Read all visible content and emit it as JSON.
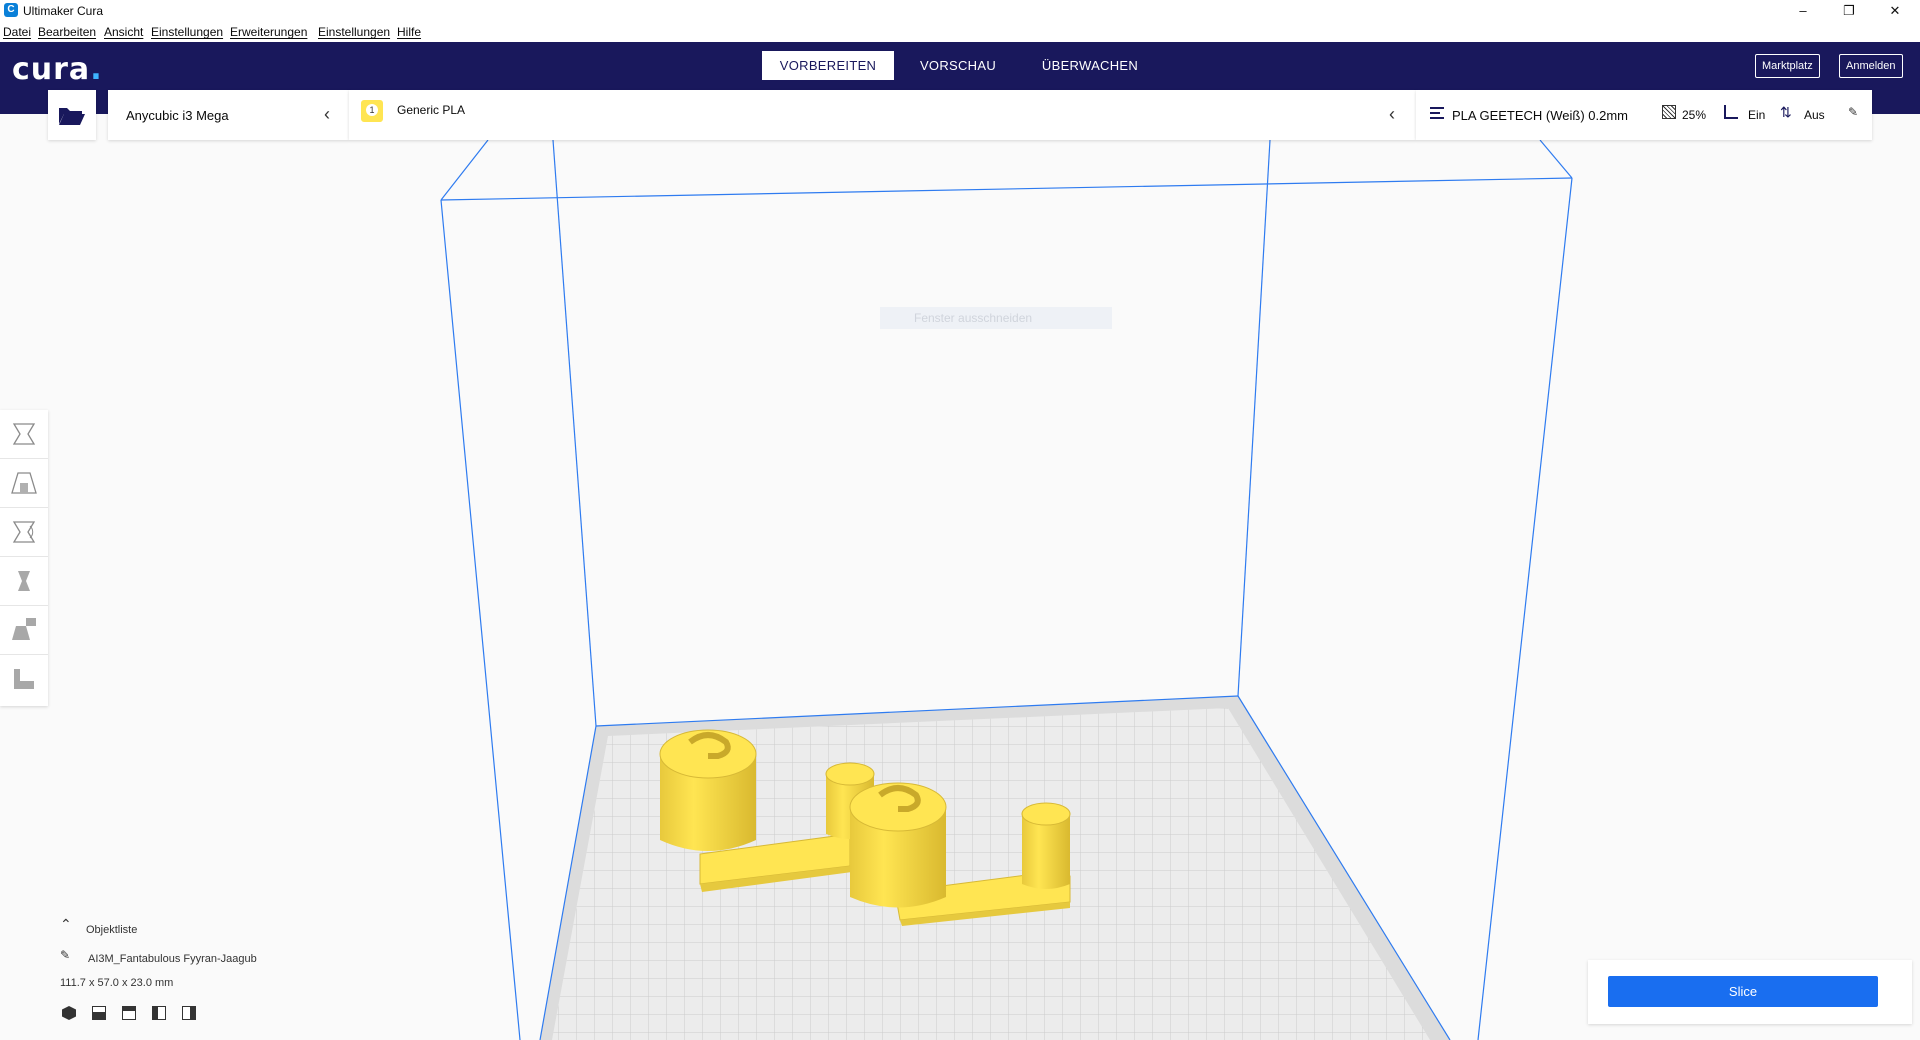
{
  "window": {
    "title": "Ultimaker Cura",
    "icon": "cura-app-icon",
    "controls": [
      "minimize-icon",
      "maximize-icon",
      "close-icon"
    ]
  },
  "menu": {
    "items": [
      "Datei",
      "Bearbeiten",
      "Ansicht",
      "Einstellungen",
      "Erweiterungen",
      "Einstellungen",
      "Hilfe"
    ]
  },
  "header": {
    "logo": "cura",
    "logo_dot": ".",
    "tabs": [
      "VORBEREITEN",
      "VORSCHAU",
      "ÜBERWACHEN"
    ],
    "active_tab": "VORBEREITEN",
    "marketplace_label": "Marktplatz",
    "signin_label": "Anmelden"
  },
  "toolbar": {
    "printer": "Anycubic i3 Mega",
    "extruder_number": "1",
    "material": "Generic PLA",
    "profile": "PLA GEETECH (Weiß) 0.2mm",
    "infill": "25%",
    "support": "Ein",
    "adhesion": "Aus"
  },
  "viewport": {
    "tooltip": "Fenster ausschneiden",
    "colors": {
      "build_volume": "#2e7bf0",
      "model": "#ffe552",
      "plate": "#e9e9e9",
      "plate_grid": "#c8c8c8"
    }
  },
  "tools": [
    "move-tool-icon",
    "scale-tool-icon",
    "rotate-tool-icon",
    "mirror-tool-icon",
    "per-model-settings-icon",
    "support-blocker-icon"
  ],
  "objects": {
    "header": "Objektliste",
    "name": "AI3M_Fantabulous Fyyran-Jaagub",
    "dimensions": "111.7 x 57.0 x 23.0 mm",
    "view_buttons": [
      "3d-view-icon",
      "front-view-icon",
      "top-view-icon",
      "left-view-icon",
      "right-view-icon"
    ]
  },
  "slice": {
    "label": "Slice",
    "color": "#196ef0"
  }
}
